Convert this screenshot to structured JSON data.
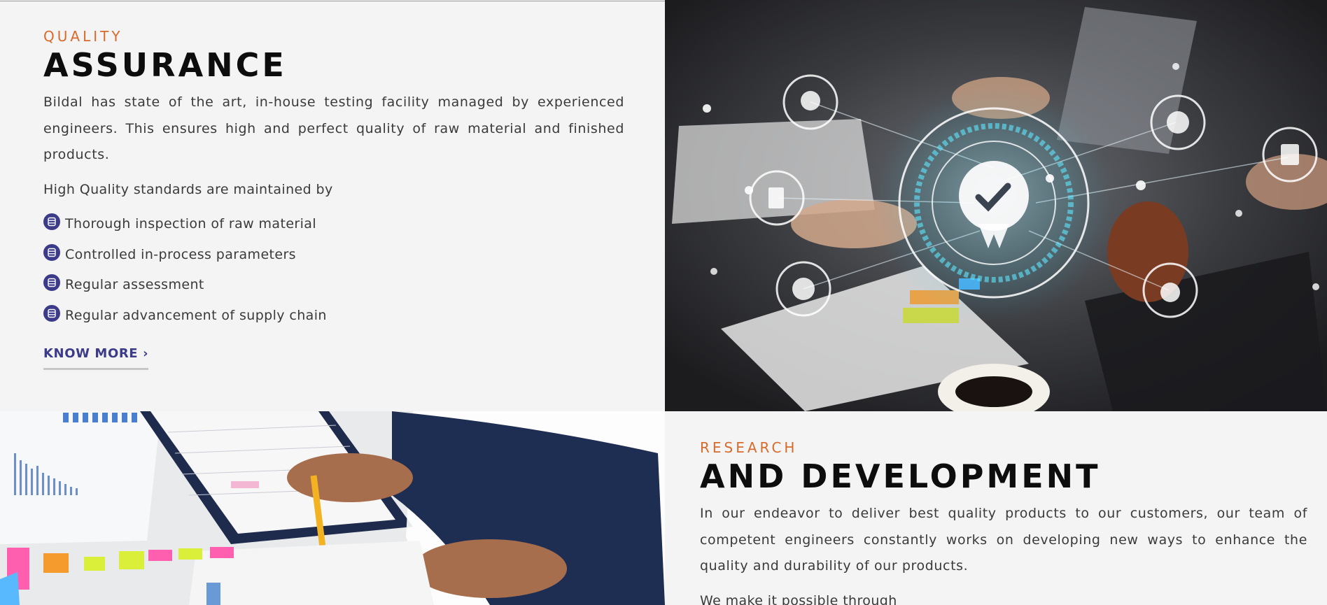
{
  "quality": {
    "eyebrow": "QUALITY",
    "heading": "ASSURANCE",
    "paragraph": "Bildal has state of the art, in-house testing facility managed by experienced engineers. This ensures high and perfect quality of raw material and finished products.",
    "subheading": "High Quality standards are maintained by",
    "points": [
      "Thorough inspection of raw material",
      "Controlled in-process parameters",
      "Regular assessment",
      "Regular advancement of supply chain"
    ],
    "cta": "KNOW MORE ›"
  },
  "research": {
    "eyebrow": "RESEARCH",
    "heading": "AND DEVELOPMENT",
    "paragraph": "In our endeavor to deliver best quality products to our customers, our team of competent engineers constantly works on developing new ways to enhance the quality and durability of our products.",
    "subheading": "We make it possible through"
  },
  "colors": {
    "accent": "#d86b2b",
    "brand": "#3b3b8a",
    "background": "#f4f4f4"
  },
  "icons": {
    "bullet": "list-icon",
    "image1": "quality-badge-network-photo",
    "image2": "documents-pencil-photo"
  }
}
